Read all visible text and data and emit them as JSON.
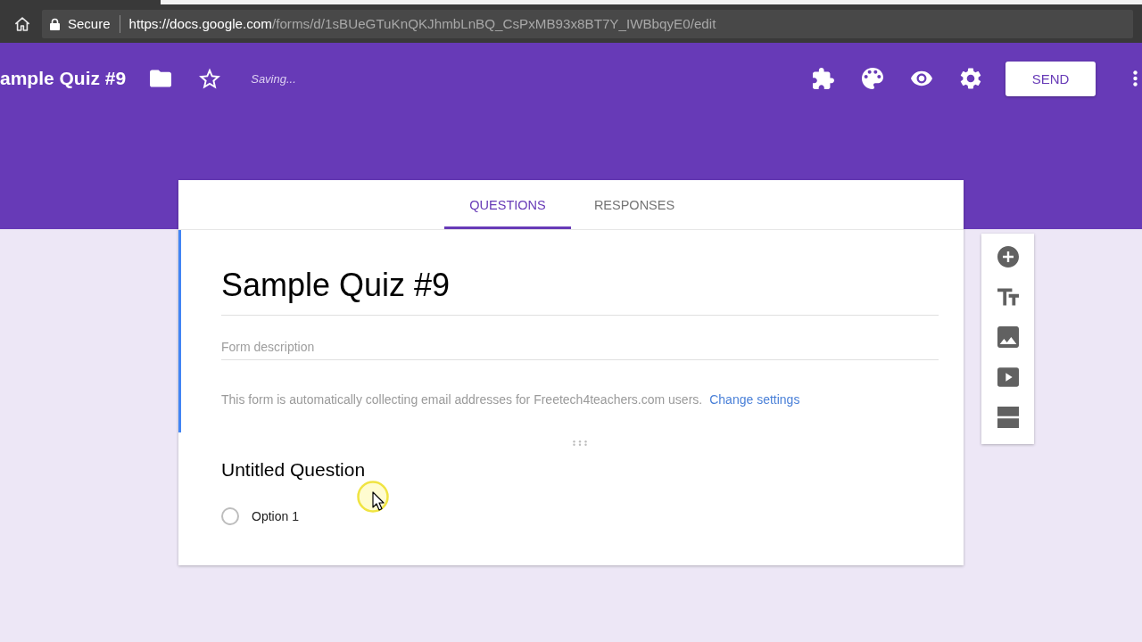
{
  "browser": {
    "secure_label": "Secure",
    "url_host": "https://docs.google.com",
    "url_path": "/forms/d/1sBUeGTuKnQKJhmbLnBQ_CsPxMB93x8BT7Y_IWBbqyE0/edit"
  },
  "header": {
    "title": "ample Quiz #9",
    "status": "Saving...",
    "send_button": "SEND"
  },
  "tabs": [
    {
      "label": "QUESTIONS",
      "selected": true
    },
    {
      "label": "RESPONSES",
      "selected": false
    }
  ],
  "form": {
    "title": "Sample Quiz #9",
    "description_placeholder": "Form description",
    "notice": "This form is automatically collecting email addresses for Freetech4teachers.com users.",
    "notice_link": "Change settings"
  },
  "question": {
    "title": "Untitled Question",
    "options": [
      {
        "label": "Option 1",
        "selected": false
      }
    ]
  }
}
